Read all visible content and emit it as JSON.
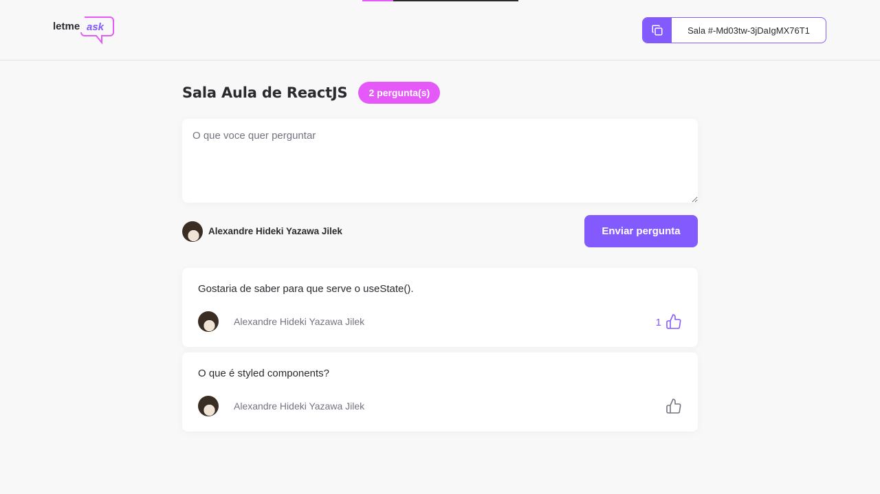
{
  "header": {
    "logo_text_main": "letme",
    "logo_text_accent": "ask",
    "room_code_label": "Sala #-Md03tw-3jDaIgMX76T1",
    "copy_icon": "copy-icon"
  },
  "room": {
    "title": "Sala Aula de ReactJS",
    "question_count_label": "2 pergunta(s)"
  },
  "form": {
    "placeholder": "O que voce quer perguntar",
    "value": "",
    "user_name": "Alexandre Hideki Yazawa Jilek",
    "submit_label": "Enviar pergunta"
  },
  "questions": [
    {
      "content": "Gostaria de saber para que serve o useState().",
      "author": "Alexandre Hideki Yazawa Jilek",
      "like_count": "1",
      "liked": true
    },
    {
      "content": "O que é styled components?",
      "author": "Alexandre Hideki Yazawa Jilek",
      "like_count": "",
      "liked": false
    }
  ],
  "colors": {
    "primary": "#835afd",
    "accent": "#e559f9",
    "background": "#f8f8f8",
    "text": "#29292e",
    "muted": "#737380"
  }
}
